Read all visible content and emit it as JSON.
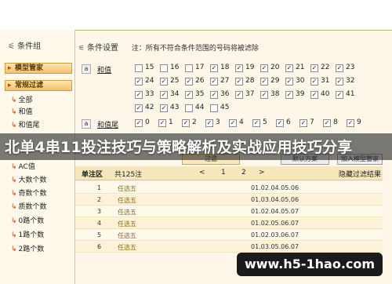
{
  "sidebar": {
    "title": "条件组",
    "groups": [
      {
        "label": "模型管家"
      },
      {
        "label": "常规过滤"
      }
    ],
    "items": [
      "全部",
      "和值",
      "和值尾",
      "AC值",
      "大数个数",
      "奇数个数",
      "质数个数",
      "0路个数",
      "1路个数",
      "2路个数"
    ]
  },
  "panel": {
    "title": "条件设置",
    "note": "注：所有不符合条件范围的号码将被滤除",
    "row1_label": "和值",
    "row2_label": "和值尾",
    "btn_a": "a"
  },
  "sum_numbers": [
    [
      15,
      16,
      17,
      18,
      19,
      20,
      21,
      22,
      23
    ],
    [
      24,
      25,
      26,
      27,
      28,
      29,
      30,
      31,
      32
    ],
    [
      33,
      34,
      35,
      36,
      37,
      38,
      39,
      40,
      41
    ],
    [
      42,
      43,
      44,
      45
    ]
  ],
  "sum_checked": [
    [
      false,
      false,
      false,
      true,
      true,
      true,
      true,
      true,
      true
    ],
    [
      true,
      true,
      true,
      true,
      true,
      true,
      true,
      true,
      true
    ],
    [
      true,
      true,
      true,
      true,
      true,
      true,
      true,
      true,
      true
    ],
    [
      true,
      true,
      false,
      false
    ]
  ],
  "tail_numbers": [
    "0",
    "1",
    "2",
    "3",
    "4",
    "5",
    "6",
    "7",
    "8",
    "9"
  ],
  "buttons": {
    "filter": "过滤",
    "default": "默认方案",
    "add": "加入模型管家"
  },
  "grid": {
    "label": "单注区",
    "count": "共125注",
    "prev": "<",
    "page1": "1",
    "page2": "2",
    "next": ">",
    "hide": "隐藏过滤结果",
    "rows": [
      {
        "idx": "1",
        "name": "任选五",
        "val": "01.02.04.05.06"
      },
      {
        "idx": "2",
        "name": "任选五",
        "val": "01.03.04.05.06"
      },
      {
        "idx": "3",
        "name": "任选五",
        "val": "01.02.04.05.07"
      },
      {
        "idx": "4",
        "name": "任选五",
        "val": "01.02.05.06.07"
      },
      {
        "idx": "5",
        "name": "任选五",
        "val": "01.02.03.06.07"
      },
      {
        "idx": "6",
        "name": "任选五",
        "val": "01.03.05.06.07"
      }
    ]
  },
  "banner": "北单4串11投注技巧与策略解析及实战应用技巧分享",
  "watermark": "www.h5-1hao.com"
}
